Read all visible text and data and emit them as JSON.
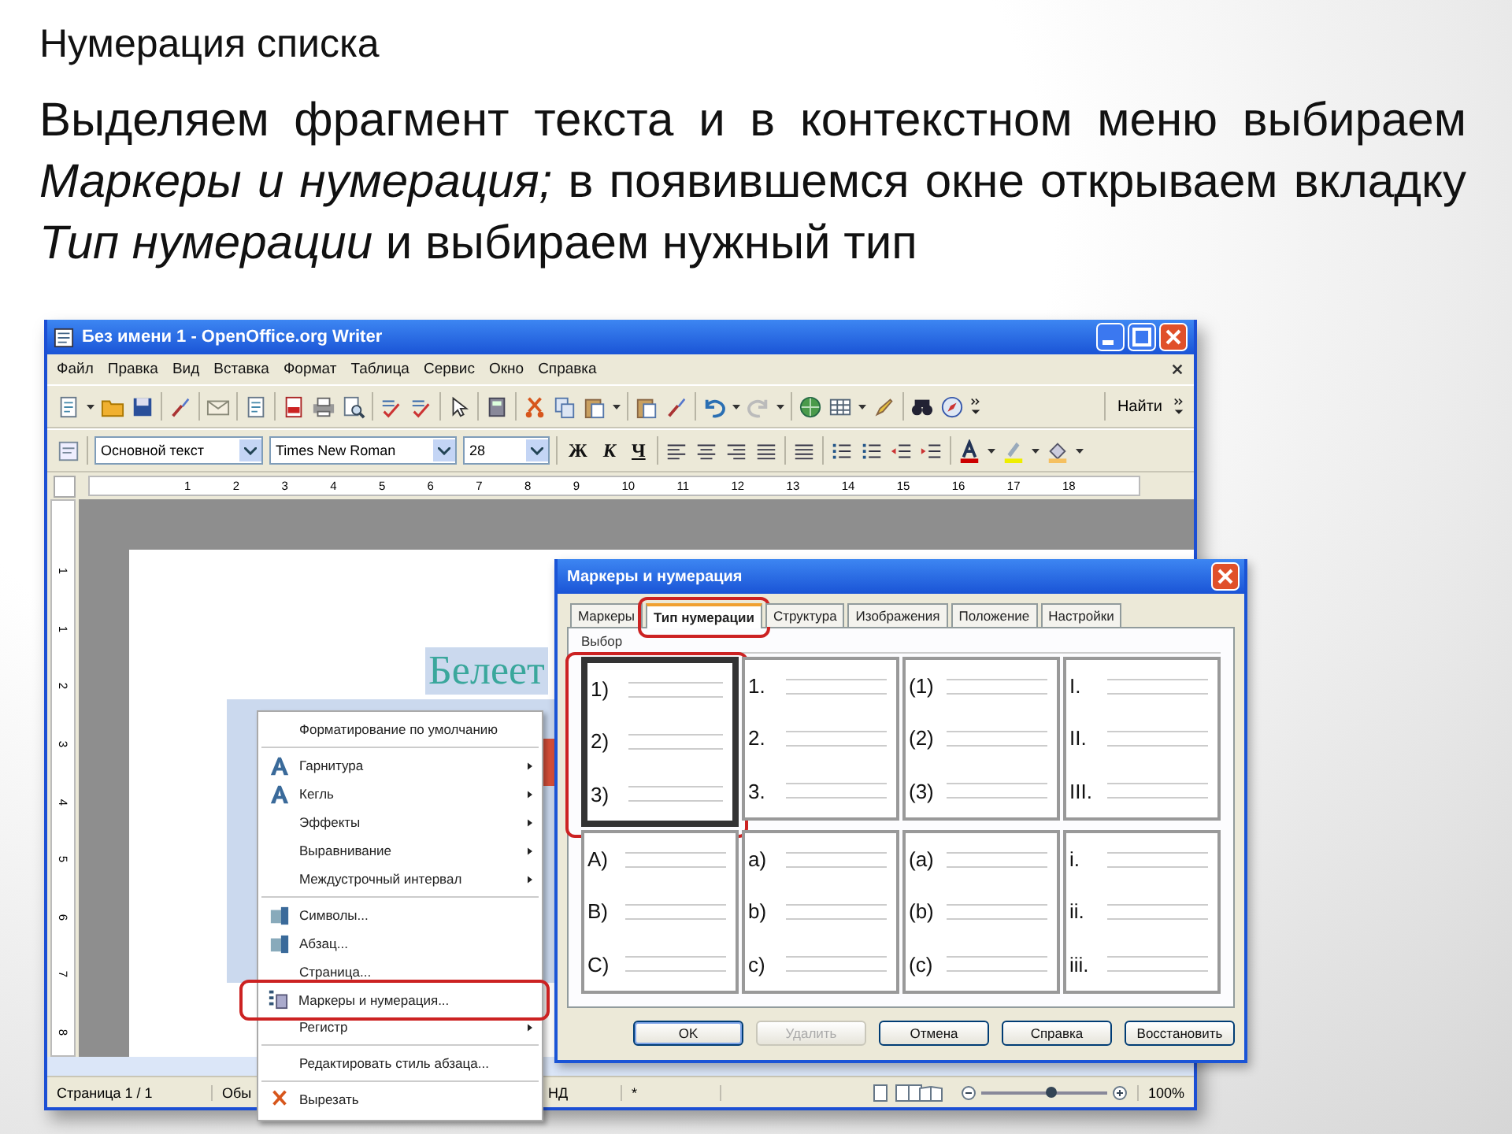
{
  "slide": {
    "title": "Нумерация списка",
    "paragraph": "Выделяем фрагмент текста и в контекстном меню выбираем *Маркеры и нумерация;* в появившемся окне открываем вкладку *Тип нумерации* и выбираем  нужный тип"
  },
  "window": {
    "title": "Без имени 1 - OpenOffice.org Writer",
    "menu": [
      "Файл",
      "Правка",
      "Вид",
      "Вставка",
      "Формат",
      "Таблица",
      "Сервис",
      "Окно",
      "Справка"
    ],
    "find_button": "Найти",
    "paragraph_style": "Основной текст",
    "font_name": "Times New Roman",
    "font_size": "28",
    "format_buttons": [
      {
        "label": "Ж",
        "kind": "bold"
      },
      {
        "label": "К",
        "kind": "italic"
      },
      {
        "label": "Ч",
        "kind": "underline"
      }
    ],
    "ruler": [
      "1",
      "2",
      "3",
      "4",
      "5",
      "6",
      "7",
      "8",
      "9",
      "10",
      "11",
      "12",
      "13",
      "14",
      "15",
      "16",
      "17",
      "18"
    ],
    "vertical_ruler": [
      "1",
      "1",
      "2",
      "3",
      "4",
      "5",
      "6",
      "7",
      "8"
    ],
    "document_text": "Белеет",
    "status_bar": {
      "fields": [
        "Страница 1 / 1",
        "Обы",
        "НД",
        "*"
      ],
      "zoom": {
        "level": 0.55
      },
      "zoom_reading": "100%"
    }
  },
  "context_menu": [
    {
      "kind": "item",
      "label": "Форматирование по умолчанию",
      "submenu": false,
      "highlighted": false
    },
    {
      "kind": "separator"
    },
    {
      "kind": "item",
      "label": "Гарнитура",
      "submenu": true,
      "highlighted": false
    },
    {
      "kind": "item",
      "label": "Кегль",
      "submenu": true,
      "highlighted": false
    },
    {
      "kind": "item",
      "label": "Эффекты",
      "submenu": true,
      "highlighted": false
    },
    {
      "kind": "item",
      "label": "Выравнивание",
      "submenu": true,
      "highlighted": false
    },
    {
      "kind": "item",
      "label": "Междустрочный интервал",
      "submenu": true,
      "highlighted": false
    },
    {
      "kind": "separator"
    },
    {
      "kind": "item",
      "label": "Символы...",
      "submenu": false,
      "highlighted": false
    },
    {
      "kind": "item",
      "label": "Абзац...",
      "submenu": false,
      "highlighted": false
    },
    {
      "kind": "item",
      "label": "Страница...",
      "submenu": false,
      "highlighted": false
    },
    {
      "kind": "item",
      "label": "Маркеры и нумерация...",
      "submenu": false,
      "highlighted": true
    },
    {
      "kind": "item",
      "label": "Регистр",
      "submenu": true,
      "highlighted": false
    },
    {
      "kind": "separator"
    },
    {
      "kind": "item",
      "label": "Редактировать стиль абзаца...",
      "submenu": false,
      "highlighted": false
    },
    {
      "kind": "separator"
    },
    {
      "kind": "item",
      "label": "Вырезать",
      "submenu": false,
      "highlighted": false
    }
  ],
  "dialog": {
    "title": "Маркеры и нумерация",
    "tabs": [
      {
        "label": "Маркеры",
        "selected": false,
        "highlighted": false
      },
      {
        "label": "Тип нумерации",
        "selected": true,
        "highlighted": true
      },
      {
        "label": "Структура",
        "selected": false,
        "highlighted": false
      },
      {
        "label": "Изображения",
        "selected": false,
        "highlighted": false
      },
      {
        "label": "Положение",
        "selected": false,
        "highlighted": false
      },
      {
        "label": "Настройки",
        "selected": false,
        "highlighted": false
      }
    ],
    "section_label": "Выбор",
    "cells": [
      {
        "labels": [
          "1)",
          "2)",
          "3)"
        ],
        "selected": true,
        "highlighted": true
      },
      {
        "labels": [
          "1.",
          "2.",
          "3."
        ],
        "selected": false,
        "highlighted": false
      },
      {
        "labels": [
          "(1)",
          "(2)",
          "(3)"
        ],
        "selected": false,
        "highlighted": false
      },
      {
        "labels": [
          "I.",
          "II.",
          "III."
        ],
        "selected": false,
        "highlighted": false
      },
      {
        "labels": [
          "A)",
          "B)",
          "C)"
        ],
        "selected": false,
        "highlighted": false
      },
      {
        "labels": [
          "a)",
          "b)",
          "c)"
        ],
        "selected": false,
        "highlighted": false
      },
      {
        "labels": [
          "(a)",
          "(b)",
          "(c)"
        ],
        "selected": false,
        "highlighted": false
      },
      {
        "labels": [
          "i.",
          "ii.",
          "iii."
        ],
        "selected": false,
        "highlighted": false
      }
    ],
    "buttons": [
      {
        "label": "OK",
        "disabled": false,
        "default": true
      },
      {
        "label": "Удалить",
        "disabled": true,
        "default": false
      },
      {
        "label": "Отмена",
        "disabled": false,
        "default": false
      },
      {
        "label": "Справка",
        "disabled": false,
        "default": false
      },
      {
        "label": "Восстановить",
        "disabled": false,
        "default": false
      }
    ]
  }
}
